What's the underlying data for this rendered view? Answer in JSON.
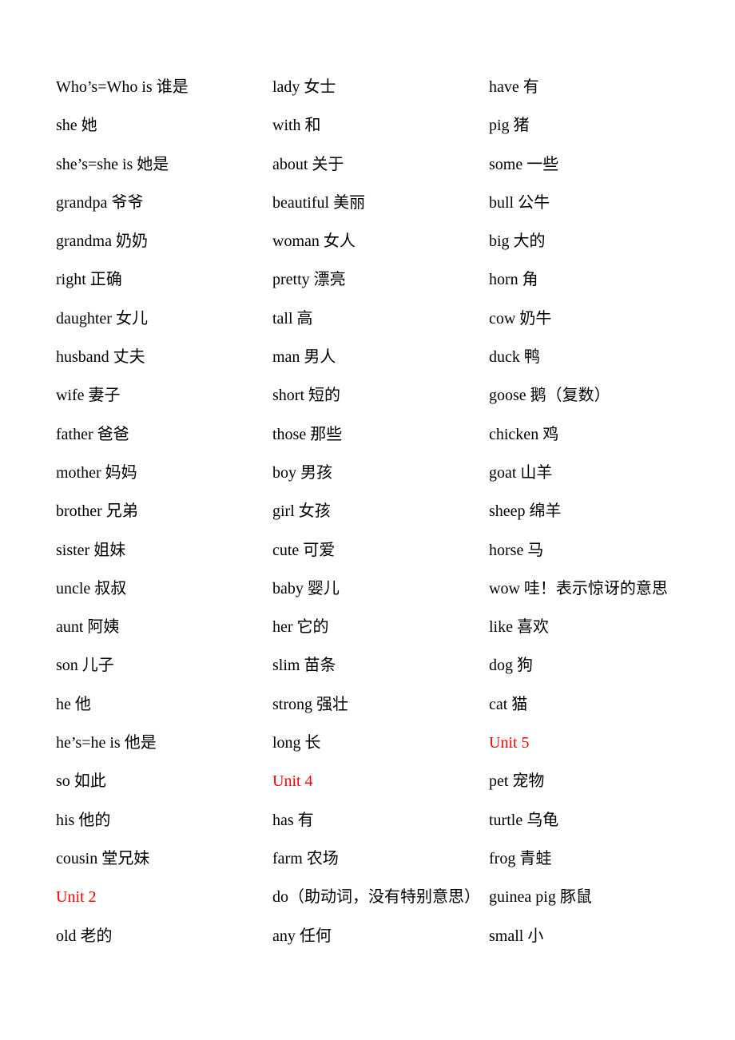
{
  "document": {
    "accent_color": "#ff0000",
    "columns": [
      {
        "entries": [
          {
            "text": "Who’s=Who is  谁是",
            "heading": false
          },
          {
            "text": "she 她",
            "heading": false
          },
          {
            "text": "she’s=she is  她是",
            "heading": false
          },
          {
            "text": "grandpa 爷爷",
            "heading": false
          },
          {
            "text": "grandma 奶奶",
            "heading": false
          },
          {
            "text": "right 正确",
            "heading": false
          },
          {
            "text": "daughter 女儿",
            "heading": false
          },
          {
            "text": "husband 丈夫",
            "heading": false
          },
          {
            "text": "wife 妻子",
            "heading": false
          },
          {
            "text": "father 爸爸",
            "heading": false
          },
          {
            "text": "mother 妈妈",
            "heading": false
          },
          {
            "text": "brother 兄弟",
            "heading": false
          },
          {
            "text": "sister 姐妹",
            "heading": false
          },
          {
            "text": "uncle 叔叔",
            "heading": false
          },
          {
            "text": "aunt 阿姨",
            "heading": false
          },
          {
            "text": "son 儿子",
            "heading": false
          },
          {
            "text": "he 他",
            "heading": false
          },
          {
            "text": "he’s=he is  他是",
            "heading": false
          },
          {
            "text": "so 如此",
            "heading": false
          },
          {
            "text": "his 他的",
            "heading": false
          },
          {
            "text": "cousin 堂兄妹",
            "heading": false
          },
          {
            "text": "Unit 2",
            "heading": true
          },
          {
            "text": "old 老的",
            "heading": false
          }
        ]
      },
      {
        "entries": [
          {
            "text": "lady 女士",
            "heading": false
          },
          {
            "text": "with 和",
            "heading": false
          },
          {
            "text": "about 关于",
            "heading": false
          },
          {
            "text": "beautiful 美丽",
            "heading": false
          },
          {
            "text": "woman 女人",
            "heading": false
          },
          {
            "text": "pretty 漂亮",
            "heading": false
          },
          {
            "text": "tall 高",
            "heading": false
          },
          {
            "text": "man 男人",
            "heading": false
          },
          {
            "text": "short 短的",
            "heading": false
          },
          {
            "text": "those 那些",
            "heading": false
          },
          {
            "text": "boy 男孩",
            "heading": false
          },
          {
            "text": "girl 女孩",
            "heading": false
          },
          {
            "text": "cute 可爱",
            "heading": false
          },
          {
            "text": "baby 婴儿",
            "heading": false
          },
          {
            "text": "her 它的",
            "heading": false
          },
          {
            "text": "slim 苗条",
            "heading": false
          },
          {
            "text": "strong 强壮",
            "heading": false
          },
          {
            "text": "long 长",
            "heading": false
          },
          {
            "text": "Unit 4",
            "heading": true
          },
          {
            "text": "has 有",
            "heading": false
          },
          {
            "text": "farm 农场",
            "heading": false
          },
          {
            "text": "do（助动词，没有特别意思）",
            "heading": false
          },
          {
            "text": "any 任何",
            "heading": false
          }
        ]
      },
      {
        "entries": [
          {
            "text": "have 有",
            "heading": false
          },
          {
            "text": "pig 猪",
            "heading": false
          },
          {
            "text": "some 一些",
            "heading": false
          },
          {
            "text": "bull 公牛",
            "heading": false
          },
          {
            "text": "big 大的",
            "heading": false
          },
          {
            "text": "horn 角",
            "heading": false
          },
          {
            "text": "cow 奶牛",
            "heading": false
          },
          {
            "text": "duck 鸭",
            "heading": false
          },
          {
            "text": "goose 鹅（复数）",
            "heading": false
          },
          {
            "text": "chicken 鸡",
            "heading": false
          },
          {
            "text": "goat 山羊",
            "heading": false
          },
          {
            "text": "sheep 绵羊",
            "heading": false
          },
          {
            "text": "horse 马",
            "heading": false
          },
          {
            "text": "wow 哇！表示惊讶的意思",
            "heading": false
          },
          {
            "text": "like 喜欢",
            "heading": false
          },
          {
            "text": "dog 狗",
            "heading": false
          },
          {
            "text": "cat 猫",
            "heading": false
          },
          {
            "text": "Unit 5",
            "heading": true
          },
          {
            "text": "pet 宠物",
            "heading": false
          },
          {
            "text": "turtle 乌龟",
            "heading": false
          },
          {
            "text": "frog 青蛙",
            "heading": false
          },
          {
            "text": "guinea pig 豚鼠",
            "heading": false
          },
          {
            "text": "small 小",
            "heading": false
          }
        ]
      }
    ]
  }
}
